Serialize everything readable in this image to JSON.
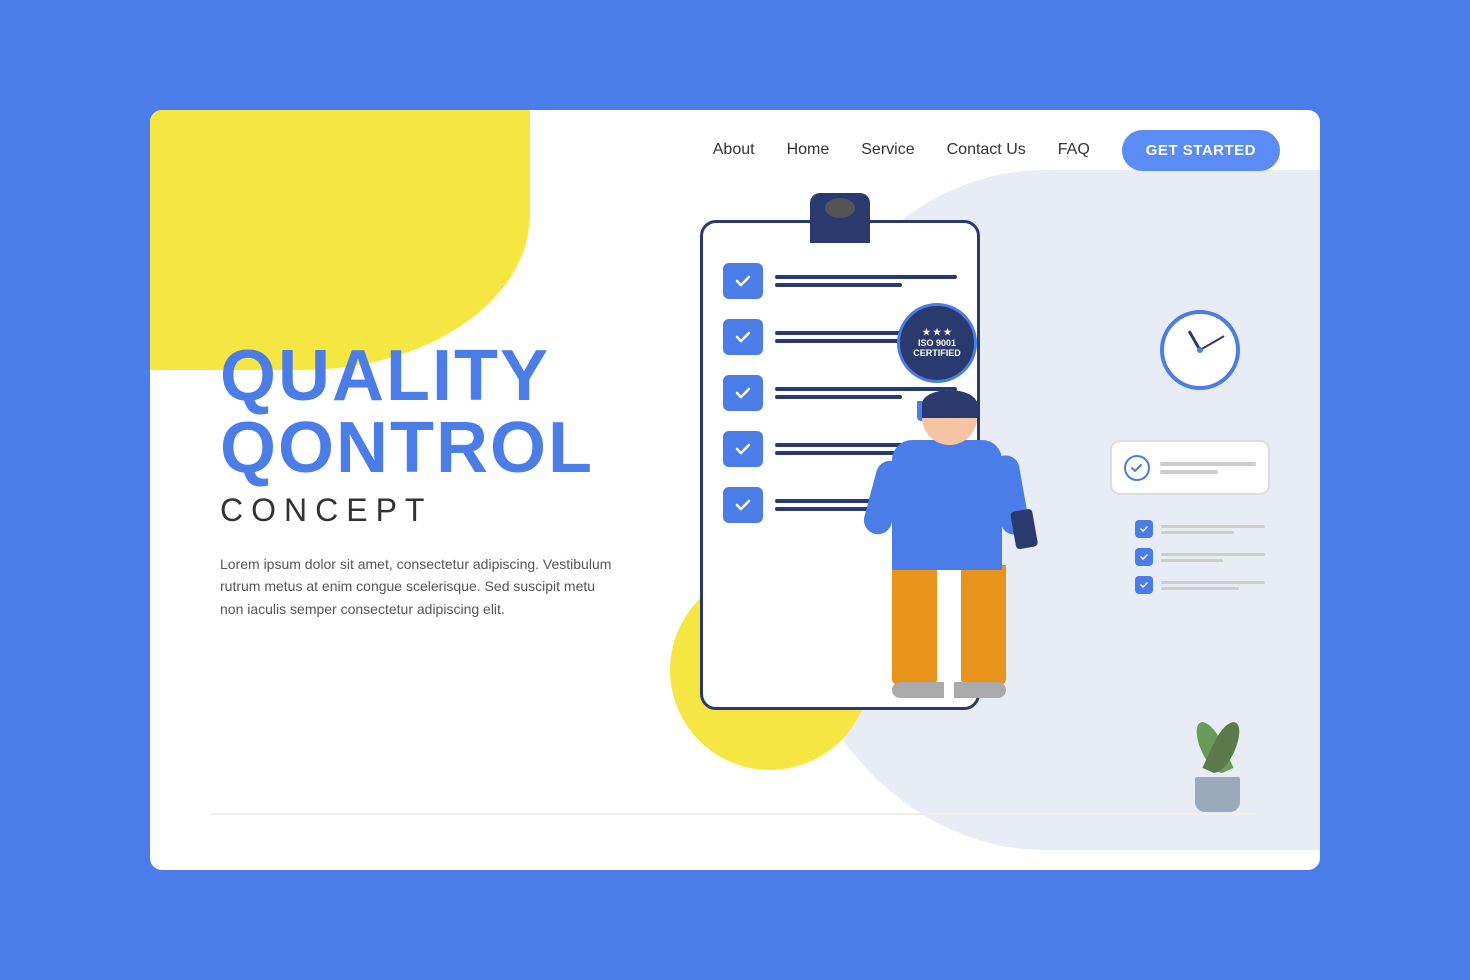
{
  "page": {
    "background_color": "#4A7DE8"
  },
  "nav": {
    "links": [
      {
        "id": "about",
        "label": "About"
      },
      {
        "id": "home",
        "label": "Home"
      },
      {
        "id": "service",
        "label": "Service"
      },
      {
        "id": "contact",
        "label": "Contact Us"
      },
      {
        "id": "faq",
        "label": "FAQ"
      }
    ],
    "cta_label": "GET STARTED"
  },
  "hero": {
    "title_line1": "QUALITY",
    "title_line2": "QONTROL",
    "title_line3": "CONCEPT",
    "description": "Lorem ipsum dolor sit amet, consectetur adipiscing. Vestibulum rutrum metus at enim congue scelerisque. Sed suscipit metu non iaculis semper consectetur adipiscing elit."
  },
  "badge": {
    "text_line1": "★★★",
    "text_line2": "ISO 9001",
    "text_line3": "CERTIFIED"
  }
}
